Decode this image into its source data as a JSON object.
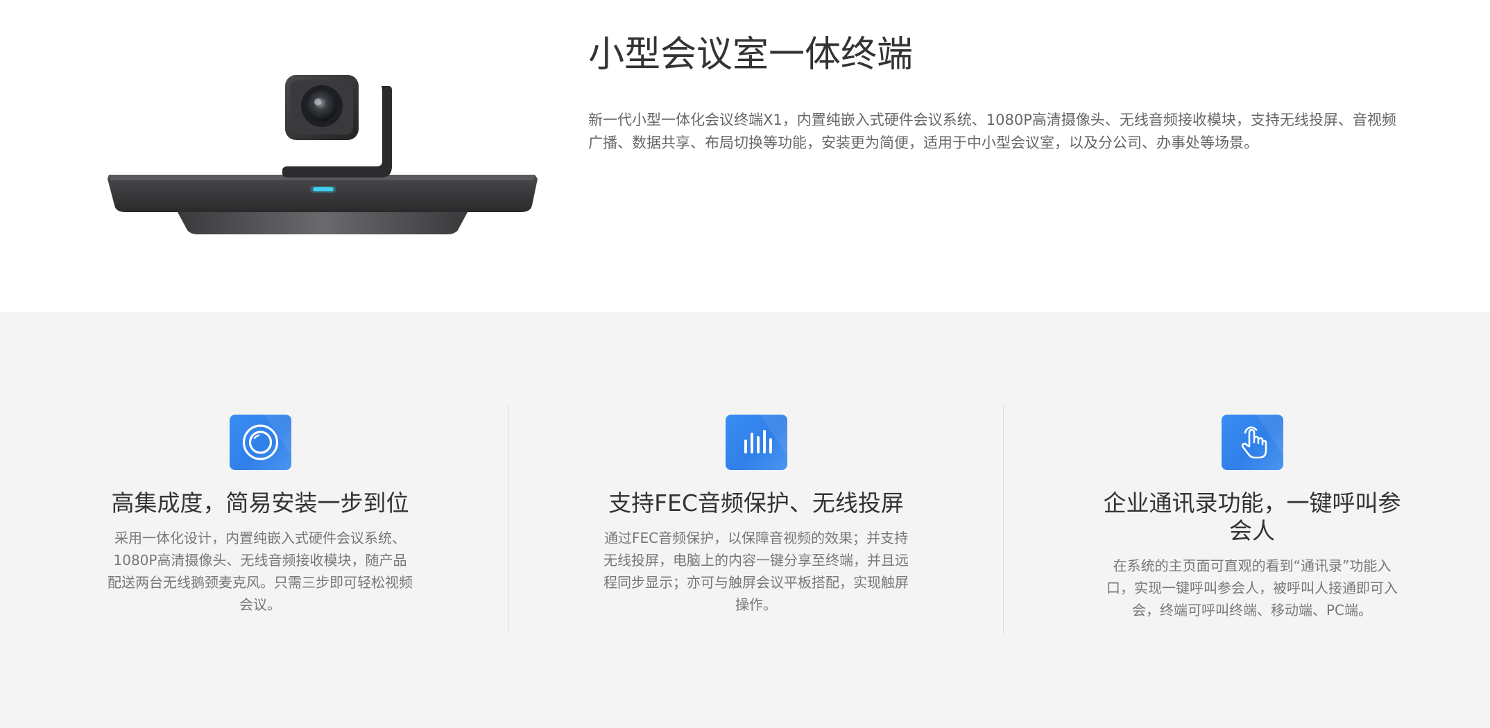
{
  "product": {
    "title": "小型会议室一体终端",
    "description": "新一代小型一体化会议终端X1，内置纯嵌入式硬件会议系统、1080P高清摄像头、无线音频接收模块，支持无线投屏、音视频广播、数据共享、布局切换等功能，安装更为简便，适用于中小型会议室，以及分公司、办事处等场景。",
    "image_icon": "conference-terminal-image"
  },
  "features": [
    {
      "icon": "camera-lens-icon",
      "title": "高集成度，简易安装一步到位",
      "description": "采用一体化设计，内置纯嵌入式硬件会议系统、1080P高清摄像头、无线音频接收模块，随产品配送两台无线鹅颈麦克风。只需三步即可轻松视频会议。"
    },
    {
      "icon": "audio-bars-icon",
      "title": "支持FEC音频保护、无线投屏",
      "description": "通过FEC音频保护，以保障音视频的效果；并支持无线投屏，电脑上的内容一键分享至终端，并且远程同步显示；亦可与触屏会议平板搭配，实现触屏操作。"
    },
    {
      "icon": "touch-hand-icon",
      "title": "企业通讯录功能，一键呼叫参会人",
      "description": "在系统的主页面可直观的看到“通讯录”功能入口，实现一键呼叫参会人，被呼叫人接通即可入会，终端可呼叫终端、移动端、PC端。"
    }
  ],
  "colors": {
    "accent": "#3b8ef3",
    "background_alt": "#f4f4f4",
    "title_text": "#333333",
    "body_text": "#777777"
  }
}
